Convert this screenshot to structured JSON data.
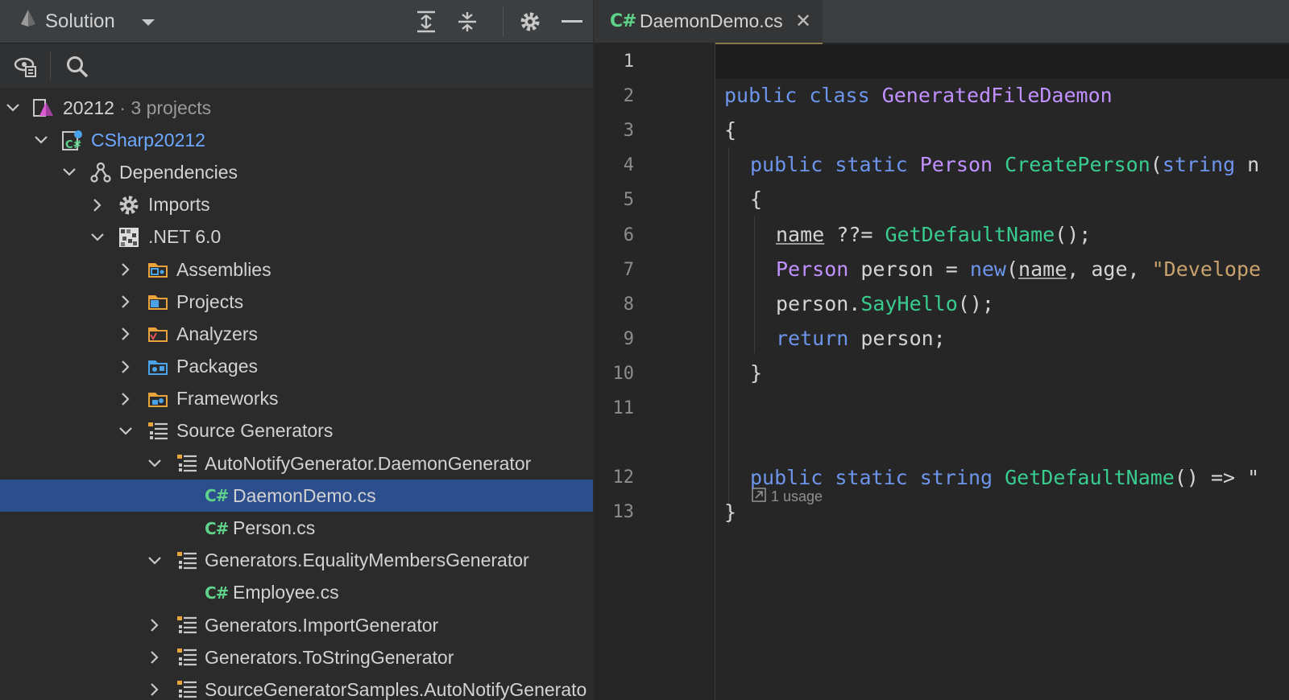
{
  "solution_panel": {
    "title": "Solution",
    "dropdown_icon": "caret-down-icon",
    "toolbar_icons": [
      "expand-all-icon",
      "collapse-all-icon",
      "gear-icon",
      "minimize-icon"
    ],
    "secondary_icons": [
      "track-active-file-icon",
      "search-icon"
    ]
  },
  "tree": {
    "solution": {
      "name": "20212",
      "suffix": "· 3 projects"
    },
    "project": {
      "name": "CSharp20212"
    },
    "dependencies": "Dependencies",
    "imports": "Imports",
    "net": ".NET 6.0",
    "assemblies": "Assemblies",
    "projects": "Projects",
    "analyzers": "Analyzers",
    "packages": "Packages",
    "frameworks": "Frameworks",
    "source_generators": "Source Generators",
    "gen_autonotify": "AutoNotifyGenerator.DaemonGenerator",
    "file_daemondemo": "DaemonDemo.cs",
    "file_person": "Person.cs",
    "gen_equality": "Generators.EqualityMembersGenerator",
    "file_employee": "Employee.cs",
    "gen_import": "Generators.ImportGenerator",
    "gen_tostring": "Generators.ToStringGenerator",
    "gen_samples": "SourceGeneratorSamples.AutoNotifyGenerato",
    "cs_badge": "C#"
  },
  "editor": {
    "tab": {
      "badge": "C#",
      "name": "DaemonDemo.cs",
      "close": "✕"
    },
    "line_numbers": [
      "1",
      "2",
      "3",
      "4",
      "5",
      "6",
      "7",
      "8",
      "9",
      "10",
      "11",
      "12",
      "13"
    ],
    "usage_hint": "1 usage",
    "tokens": {
      "l2_public": "public",
      "l2_class": "class",
      "l2_name": "GeneratedFileDaemon",
      "l3": "{",
      "l4_public": "public",
      "l4_static": "static",
      "l4_type": "Person",
      "l4_fn": "CreatePerson",
      "l4_paren": "(",
      "l4_kw": "string",
      "l4_rest": " n",
      "l5": "{",
      "l6_name": "name",
      "l6_op": " ??= ",
      "l6_fn": "GetDefaultName",
      "l6_end": "();",
      "l7_type": "Person",
      "l7_var": " person = ",
      "l7_new": "new",
      "l7_paren": "(",
      "l7_name": "name",
      "l7_mid": ", age, ",
      "l7_str": "\"Develope",
      "l8_var": "person.",
      "l8_fn": "SayHello",
      "l8_end": "();",
      "l9_kw": "return",
      "l9_rest": " person;",
      "l10": "}",
      "l12_public": "public",
      "l12_static": "static",
      "l12_kw": "string",
      "l12_fn": "GetDefaultName",
      "l12_rest": "() => \"",
      "l13": "}"
    }
  },
  "colors": {
    "selection": "#2d4e8c",
    "keyword": "#6c95eb",
    "type": "#c191ff",
    "method": "#39cc8f",
    "string": "#c9a26d",
    "csharp_badge": "#5fd28a"
  }
}
